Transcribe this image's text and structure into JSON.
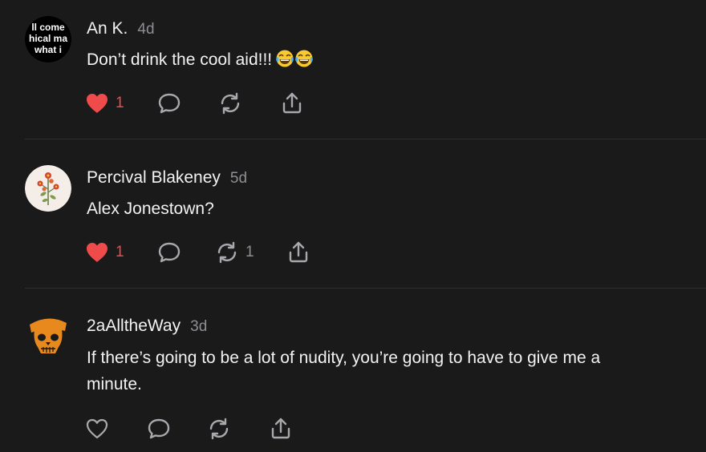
{
  "colors": {
    "background": "#1a1a1b",
    "text_primary": "#f2f2f2",
    "text_secondary": "#8e8e93",
    "like_red": "#ef4b4b",
    "icon_gray": "#a8a8ad"
  },
  "comments": [
    {
      "author": "An K.",
      "time": "4d",
      "text": "Don’t drink the cool aid!!!",
      "emoji": "face-with-tears-of-joy x2",
      "avatar_text": [
        "ll come",
        "hical ma",
        "what i"
      ],
      "liked": true,
      "likes": "1",
      "restacks": ""
    },
    {
      "author": "Percival Blakeney",
      "time": "5d",
      "text": "Alex Jonestown?",
      "liked": true,
      "likes": "1",
      "restacks": "1"
    },
    {
      "author": "2aAlltheWay",
      "time": "3d",
      "text_line1": "If there’s going to be a lot of nudity, you’re going to have to give me a",
      "text_line2": "minute.",
      "liked": false,
      "likes": "",
      "restacks": ""
    }
  ]
}
